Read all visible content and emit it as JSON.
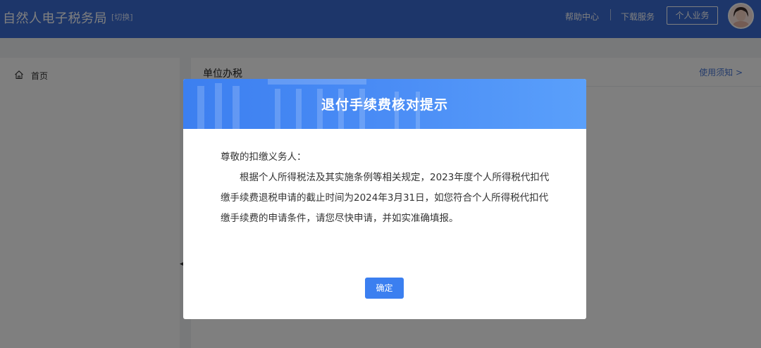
{
  "header": {
    "app_title": "自然人电子税务局",
    "switch_label": "[切换]",
    "help_center": "帮助中心",
    "download_service": "下载服务",
    "personal_business": "个人业务"
  },
  "sidebar": {
    "items": [
      {
        "label": "首页",
        "icon": "home-icon"
      }
    ]
  },
  "main": {
    "title": "单位办税",
    "notice_link": "使用须知 >"
  },
  "modal": {
    "title": "退付手续费核对提示",
    "greeting": "尊敬的扣缴义务人：",
    "body": "根据个人所得税法及其实施条例等相关规定，2023年度个人所得税代扣代缴手续费退税申请的截止时间为2024年3月31日，如您符合个人所得税代扣代缴手续费的申请条件，请您尽快申请，并如实准确填报。",
    "confirm_label": "确定"
  },
  "colors": {
    "header_bg": "#3b6cd4",
    "modal_header_start": "#3c7ff0",
    "modal_header_end": "#5aa0fb",
    "primary_button": "#3b7ff0"
  }
}
